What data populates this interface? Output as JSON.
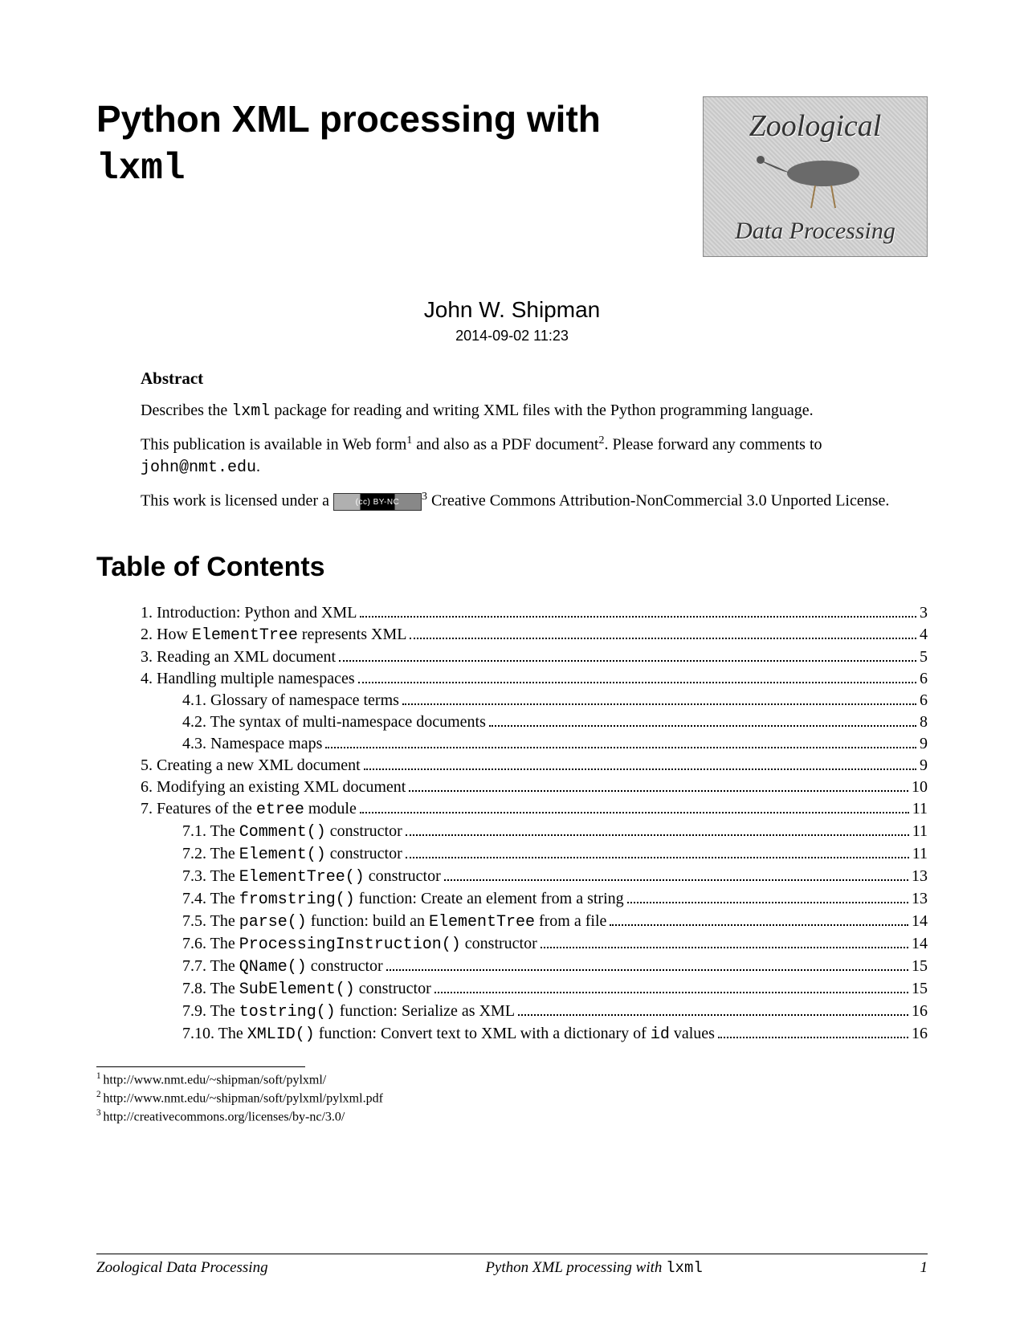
{
  "title": {
    "prefix": "Python XML processing with ",
    "mono": "lxml"
  },
  "logo": {
    "top": "Zoological",
    "bottom": "Data Processing"
  },
  "author": "John W. Shipman",
  "date": "2014-09-02 11:23",
  "abstract": {
    "heading": "Abstract",
    "p1a": "Describes the ",
    "p1b": "lxml",
    "p1c": " package for reading and writing XML files with the Python programming language.",
    "p2a": "This publication is available in Web form",
    "p2b": " and also as a PDF document",
    "p2c": ". Please forward any comments to ",
    "p2email": "john@nmt.edu",
    "p2d": ".",
    "p3a": "This work is licensed under a ",
    "ccBadge": "(cc) BY-NC",
    "p3b": " Creative Commons Attribution-NonCommercial 3.0 Unported License."
  },
  "tocHeading": "Table of Contents",
  "toc": [
    {
      "level": 0,
      "label": "1. Introduction: Python and XML",
      "page": "3"
    },
    {
      "level": 0,
      "labelParts": [
        "2. How ",
        "ElementTree",
        " represents XML"
      ],
      "page": "4"
    },
    {
      "level": 0,
      "label": "3. Reading an XML document",
      "page": "5"
    },
    {
      "level": 0,
      "label": "4. Handling multiple namespaces",
      "page": "6"
    },
    {
      "level": 1,
      "label": "4.1. Glossary of namespace terms",
      "page": "6"
    },
    {
      "level": 1,
      "label": "4.2. The syntax of multi-namespace documents",
      "page": "8"
    },
    {
      "level": 1,
      "label": "4.3. Namespace maps",
      "page": "9"
    },
    {
      "level": 0,
      "label": "5. Creating a new XML document",
      "page": "9"
    },
    {
      "level": 0,
      "label": "6. Modifying an existing XML document",
      "page": "10"
    },
    {
      "level": 0,
      "labelParts": [
        "7. Features of the ",
        "etree",
        " module"
      ],
      "page": "11"
    },
    {
      "level": 1,
      "labelParts": [
        "7.1. The ",
        "Comment()",
        " constructor"
      ],
      "page": "11"
    },
    {
      "level": 1,
      "labelParts": [
        "7.2. The ",
        "Element()",
        " constructor"
      ],
      "page": "11"
    },
    {
      "level": 1,
      "labelParts": [
        "7.3. The ",
        "ElementTree()",
        " constructor"
      ],
      "page": "13"
    },
    {
      "level": 1,
      "labelParts": [
        "7.4. The ",
        "fromstring()",
        " function: Create an element from a string"
      ],
      "page": "13"
    },
    {
      "level": 1,
      "labelParts": [
        "7.5. The ",
        "parse()",
        " function: build an ",
        "ElementTree",
        " from a file"
      ],
      "page": "14"
    },
    {
      "level": 1,
      "labelParts": [
        "7.6. The ",
        "ProcessingInstruction()",
        " constructor"
      ],
      "page": "14"
    },
    {
      "level": 1,
      "labelParts": [
        "7.7. The ",
        "QName()",
        " constructor"
      ],
      "page": "15"
    },
    {
      "level": 1,
      "labelParts": [
        "7.8. The ",
        "SubElement()",
        " constructor"
      ],
      "page": "15"
    },
    {
      "level": 1,
      "labelParts": [
        "7.9. The ",
        "tostring()",
        " function: Serialize as XML"
      ],
      "page": "16"
    },
    {
      "level": 1,
      "labelParts": [
        "7.10. The ",
        "XMLID()",
        " function: Convert text to XML with a dictionary of ",
        "id",
        " values"
      ],
      "page": "16"
    }
  ],
  "footnotes": [
    {
      "n": "1",
      "text": "http://www.nmt.edu/~shipman/soft/pylxml/"
    },
    {
      "n": "2",
      "text": "http://www.nmt.edu/~shipman/soft/pylxml/pylxml.pdf"
    },
    {
      "n": "3",
      "text": "http://creativecommons.org/licenses/by-nc/3.0/"
    }
  ],
  "sup": {
    "1": "1",
    "2": "2",
    "3": "3"
  },
  "footer": {
    "left": "Zoological Data Processing",
    "centerA": "Python XML processing with ",
    "centerB": "lxml",
    "right": "1"
  }
}
